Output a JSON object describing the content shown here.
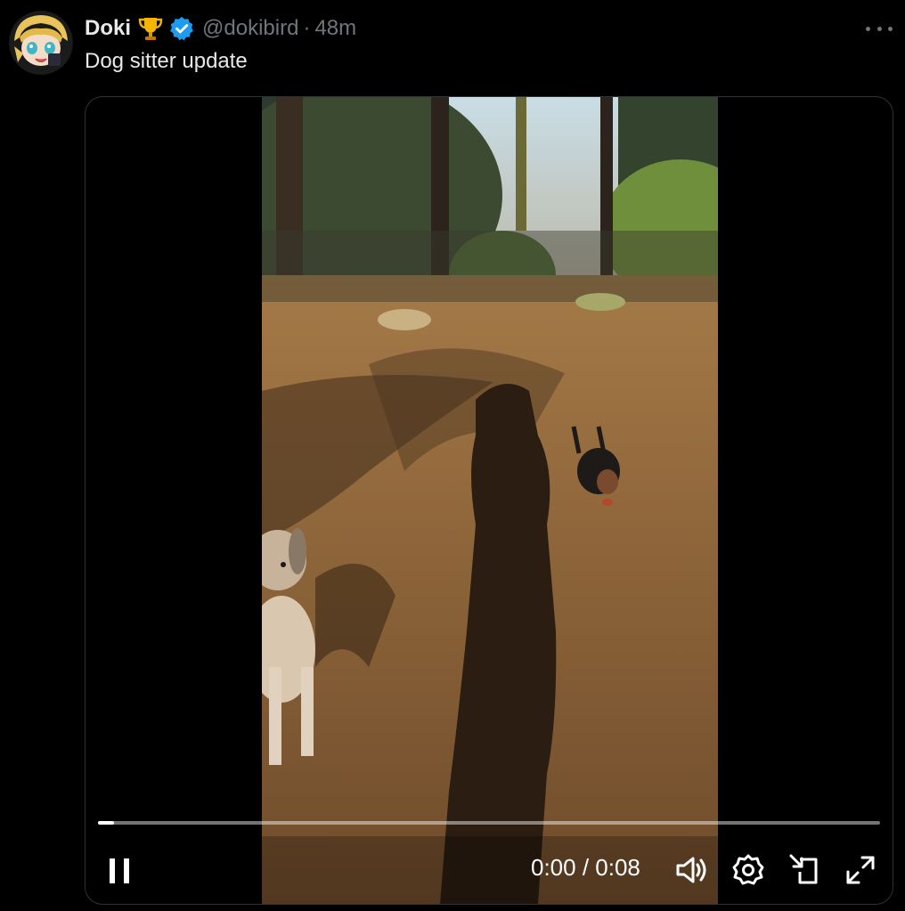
{
  "tweet": {
    "author_name": "Doki",
    "handle": "@dokibird",
    "separator": "·",
    "time": "48m",
    "text": "Dog sitter update",
    "badge_icons": [
      "trophy-icon",
      "verified-badge-icon"
    ]
  },
  "video": {
    "current_time": "0:00",
    "duration": "0:08",
    "timecode": "0:00 / 0:08",
    "progress": 0.02,
    "state": "playing"
  },
  "controls": [
    "pause-icon",
    "volume-icon",
    "settings-icon",
    "pip-icon",
    "fullscreen-icon"
  ],
  "colors": {
    "background": "#000000",
    "text_primary": "#e7e9ea",
    "text_secondary": "#71767b",
    "verified_blue": "#1d9bf0",
    "trophy_gold": "#f4b400"
  }
}
